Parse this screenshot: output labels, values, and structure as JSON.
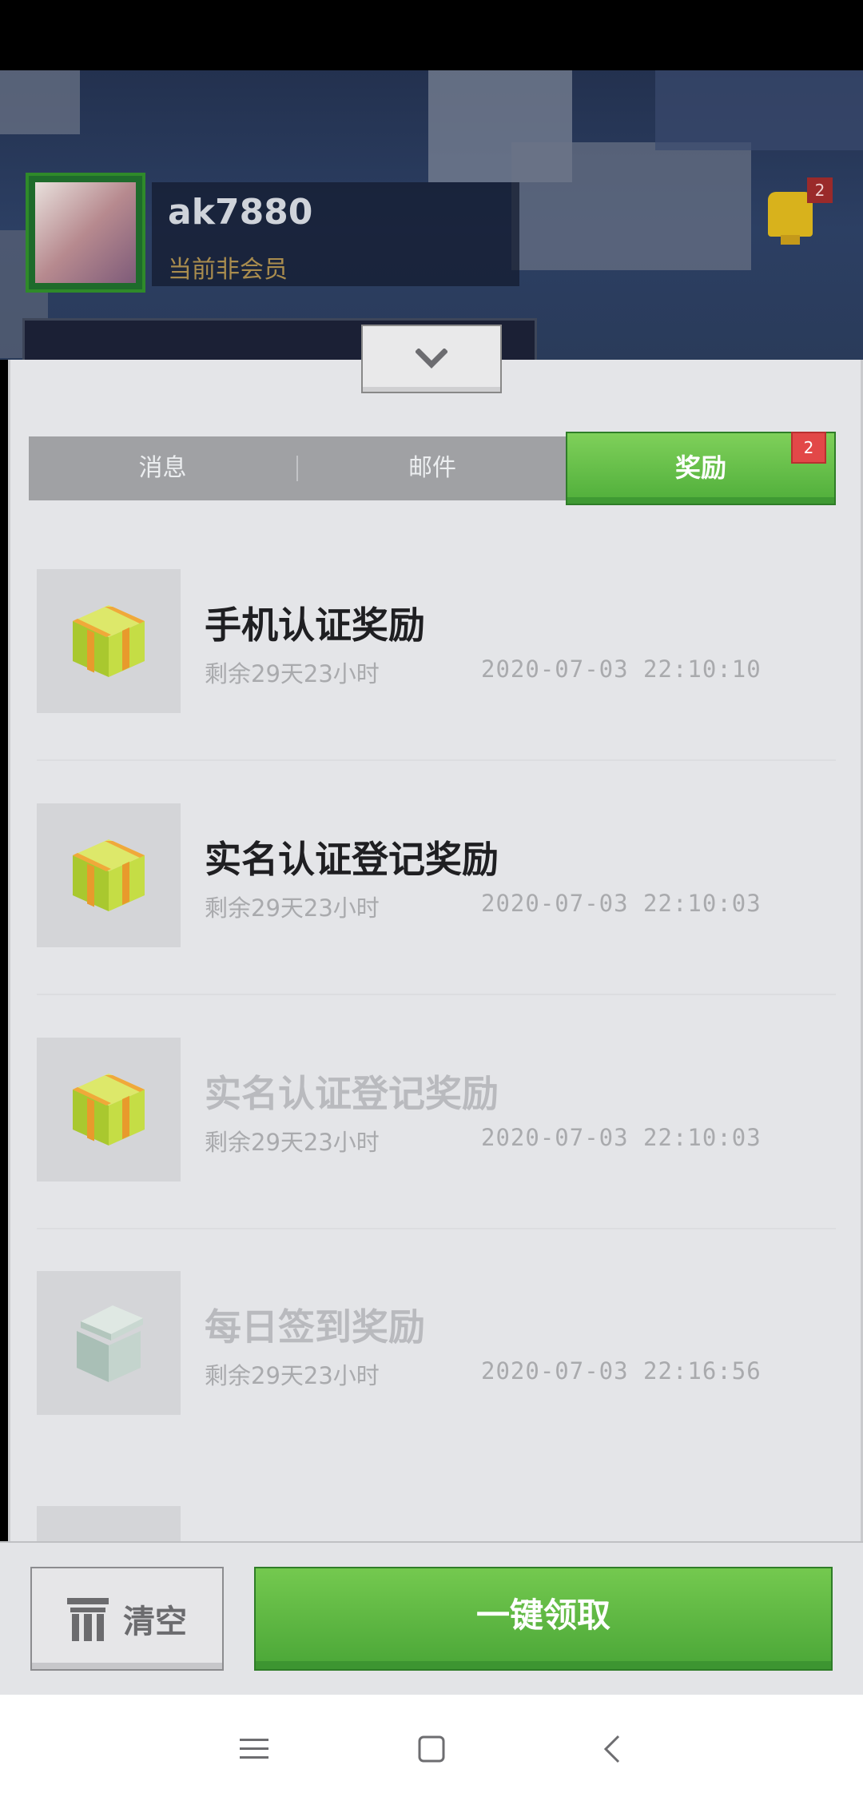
{
  "header": {
    "username": "ak7880",
    "member_status": "当前非会员",
    "notification_count": "2"
  },
  "tabs": [
    {
      "label": "消息"
    },
    {
      "label": "邮件"
    },
    {
      "label": "奖励",
      "badge": "2",
      "active": true
    }
  ],
  "rewards": [
    {
      "title": "手机认证奖励",
      "remaining": "剩余29天23小时",
      "time": "2020-07-03 22:10:10",
      "icon": "gift-closed-icon",
      "claimed": false
    },
    {
      "title": "实名认证登记奖励",
      "remaining": "剩余29天23小时",
      "time": "2020-07-03 22:10:03",
      "icon": "gift-closed-icon",
      "claimed": false
    },
    {
      "title": "实名认证登记奖励",
      "remaining": "剩余29天23小时",
      "time": "2020-07-03 22:10:03",
      "icon": "gift-closed-icon",
      "claimed": true
    },
    {
      "title": "每日签到奖励",
      "remaining": "剩余29天23小时",
      "time": "2020-07-03 22:16:56",
      "icon": "gift-open-icon",
      "claimed": true
    }
  ],
  "actions": {
    "clear_label": "清空",
    "claim_all_label": "一键领取"
  },
  "colors": {
    "accent_green": "#5bb842",
    "badge_red": "#e24848"
  }
}
